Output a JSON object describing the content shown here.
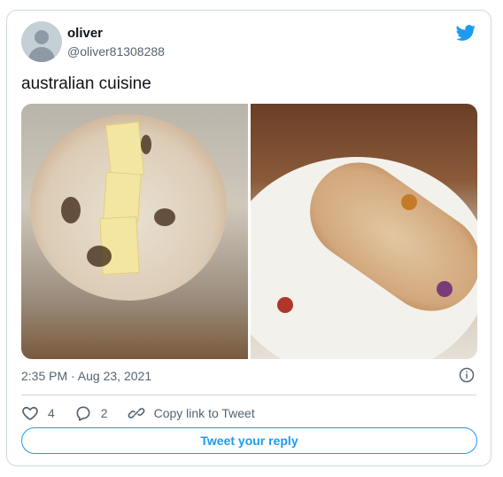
{
  "tweet": {
    "author": {
      "name": "oliver",
      "handle": "@oliver81308288"
    },
    "text": "australian cuisine",
    "timestamp": "2:35 PM · Aug 23, 2021",
    "likes": "4",
    "replies": "2",
    "copy_link_label": "Copy link to Tweet",
    "reply_button_label": "Tweet your reply"
  },
  "icons": {
    "brand": "twitter-bird-icon",
    "info": "info-icon",
    "like": "heart-icon",
    "reply": "comment-icon",
    "link": "link-icon"
  },
  "colors": {
    "accent": "#1d9bf0",
    "muted": "#536471",
    "border": "#cfd9de"
  }
}
